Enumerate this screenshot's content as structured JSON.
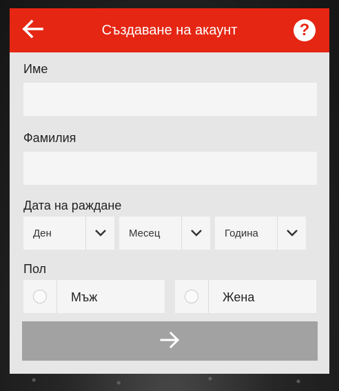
{
  "header": {
    "title": "Създаване на акаунт",
    "back_icon": "arrow-left-icon",
    "help_label": "?",
    "accent_color": "#e52613"
  },
  "form": {
    "first_name": {
      "label": "Име",
      "value": "",
      "placeholder": ""
    },
    "last_name": {
      "label": "Фамилия",
      "value": "",
      "placeholder": ""
    },
    "birthdate": {
      "label": "Дата на раждане",
      "day": "Ден",
      "month": "Месец",
      "year": "Година"
    },
    "gender": {
      "label": "Пол",
      "options": [
        "Мъж",
        "Жена"
      ]
    },
    "submit_icon": "arrow-right-icon",
    "submit_color": "#a2a2a2"
  }
}
